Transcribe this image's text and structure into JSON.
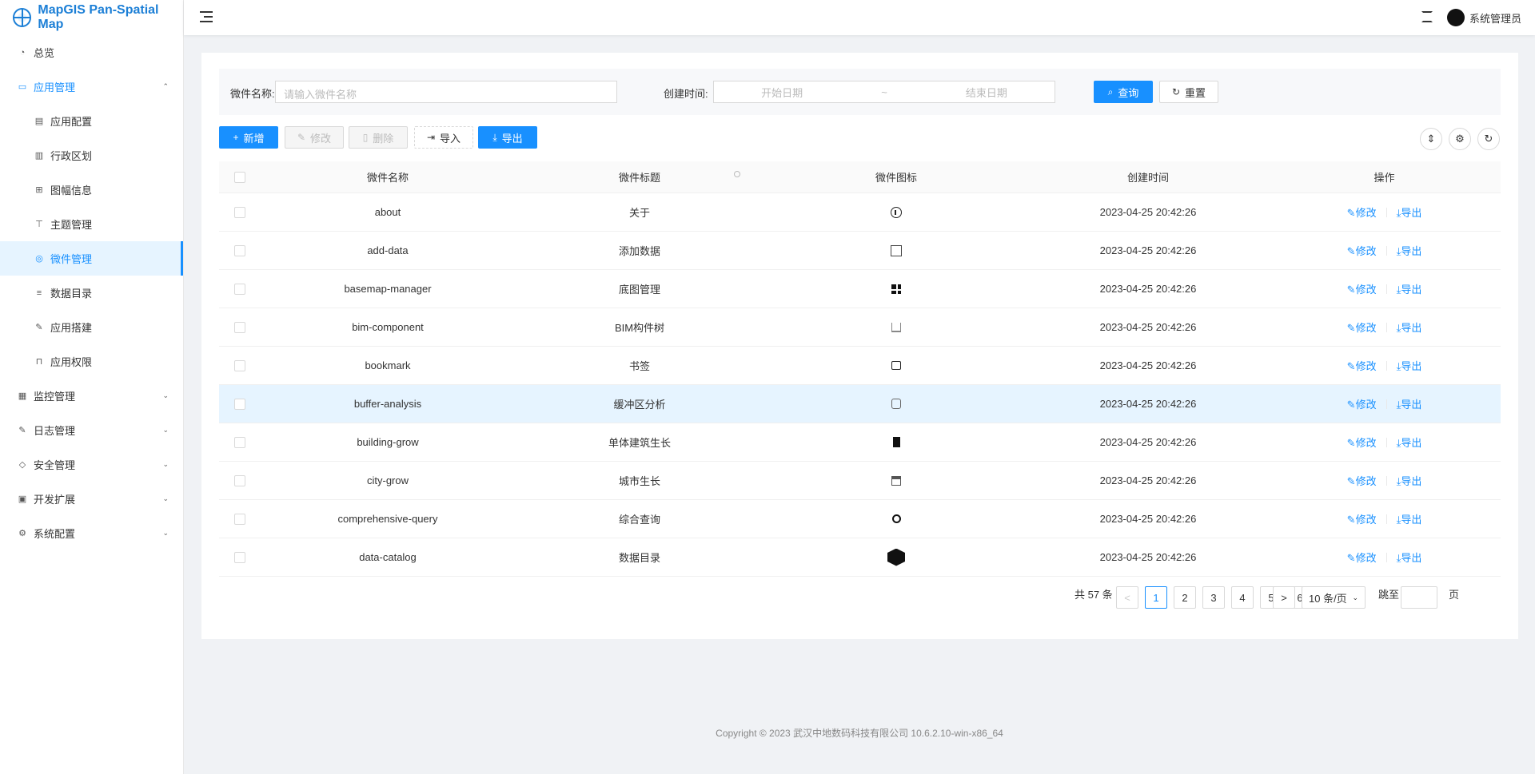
{
  "app": {
    "title": "MapGIS Pan-Spatial Map"
  },
  "header": {
    "user_name": "系统管理员"
  },
  "sidebar": {
    "items": [
      {
        "label": "总览",
        "icon": "dashboard-icon",
        "level": 0,
        "state": "normal"
      },
      {
        "label": "应用管理",
        "icon": "monitor-icon",
        "level": 0,
        "state": "open",
        "arrow": "⌃"
      },
      {
        "label": "应用配置",
        "icon": "config-icon",
        "level": 1,
        "state": "normal"
      },
      {
        "label": "行政区划",
        "icon": "layout-icon",
        "level": 1,
        "state": "normal"
      },
      {
        "label": "图幅信息",
        "icon": "grid-icon",
        "level": 1,
        "state": "normal"
      },
      {
        "label": "主题管理",
        "icon": "shirt-icon",
        "level": 1,
        "state": "normal"
      },
      {
        "label": "微件管理",
        "icon": "widget-icon",
        "level": 1,
        "state": "active"
      },
      {
        "label": "数据目录",
        "icon": "catalog-icon",
        "level": 1,
        "state": "normal"
      },
      {
        "label": "应用搭建",
        "icon": "edit-icon",
        "level": 1,
        "state": "normal"
      },
      {
        "label": "应用权限",
        "icon": "lock-icon",
        "level": 1,
        "state": "normal"
      },
      {
        "label": "监控管理",
        "icon": "chart-icon",
        "level": 0,
        "state": "normal",
        "arrow": "⌄"
      },
      {
        "label": "日志管理",
        "icon": "log-icon",
        "level": 0,
        "state": "normal",
        "arrow": "⌄"
      },
      {
        "label": "安全管理",
        "icon": "shield-icon",
        "level": 0,
        "state": "normal",
        "arrow": "⌄"
      },
      {
        "label": "开发扩展",
        "icon": "toolbox-icon",
        "level": 0,
        "state": "normal",
        "arrow": "⌄"
      },
      {
        "label": "系统配置",
        "icon": "gear-icon",
        "level": 0,
        "state": "normal",
        "arrow": "⌄"
      }
    ]
  },
  "search": {
    "name_label": "微件名称:",
    "name_placeholder": "请输入微件名称",
    "time_label": "创建时间:",
    "start_placeholder": "开始日期",
    "range_sep": "~",
    "end_placeholder": "结束日期",
    "query_label": "查询",
    "reset_label": "重置"
  },
  "toolbar": {
    "add_label": "新增",
    "edit_label": "修改",
    "delete_label": "删除",
    "import_label": "导入",
    "export_label": "导出"
  },
  "table": {
    "columns": [
      "微件名称",
      "微件标题",
      "微件图标",
      "创建时间",
      "操作"
    ],
    "edit_action": "修改",
    "export_action": "导出",
    "rows": [
      {
        "name": "about",
        "title": "关于",
        "icon": "info-icon",
        "created": "2023-04-25 20:42:26"
      },
      {
        "name": "add-data",
        "title": "添加数据",
        "icon": "grid-add-icon",
        "created": "2023-04-25 20:42:26"
      },
      {
        "name": "basemap-manager",
        "title": "底图管理",
        "icon": "grid-fill-icon",
        "created": "2023-04-25 20:42:26"
      },
      {
        "name": "bim-component",
        "title": "BIM构件树",
        "icon": "bim-icon",
        "created": "2023-04-25 20:42:26"
      },
      {
        "name": "bookmark",
        "title": "书签",
        "icon": "bookmark-icon",
        "created": "2023-04-25 20:42:26"
      },
      {
        "name": "buffer-analysis",
        "title": "缓冲区分析",
        "icon": "buffer-icon",
        "created": "2023-04-25 20:42:26"
      },
      {
        "name": "building-grow",
        "title": "单体建筑生长",
        "icon": "building-icon",
        "created": "2023-04-25 20:42:26"
      },
      {
        "name": "city-grow",
        "title": "城市生长",
        "icon": "city-icon",
        "created": "2023-04-25 20:42:26"
      },
      {
        "name": "comprehensive-query",
        "title": "综合查询",
        "icon": "query-icon",
        "created": "2023-04-25 20:42:26"
      },
      {
        "name": "data-catalog",
        "title": "数据目录",
        "icon": "cube-icon",
        "created": "2023-04-25 20:42:26"
      }
    ]
  },
  "pagination": {
    "total_label": "共 57 条",
    "prev": "<",
    "next": ">",
    "pages": [
      "1",
      "2",
      "3",
      "4",
      "5",
      "6"
    ],
    "current": "1",
    "page_size": "10 条/页",
    "jump_label": "跳至",
    "page_suffix": "页"
  },
  "footer": {
    "text": "Copyright © 2023 武汉中地数码科技有限公司 10.6.2.10-win-x86_64"
  },
  "colors": {
    "accent": "#1890ff",
    "brand": "#1c7fd6"
  }
}
